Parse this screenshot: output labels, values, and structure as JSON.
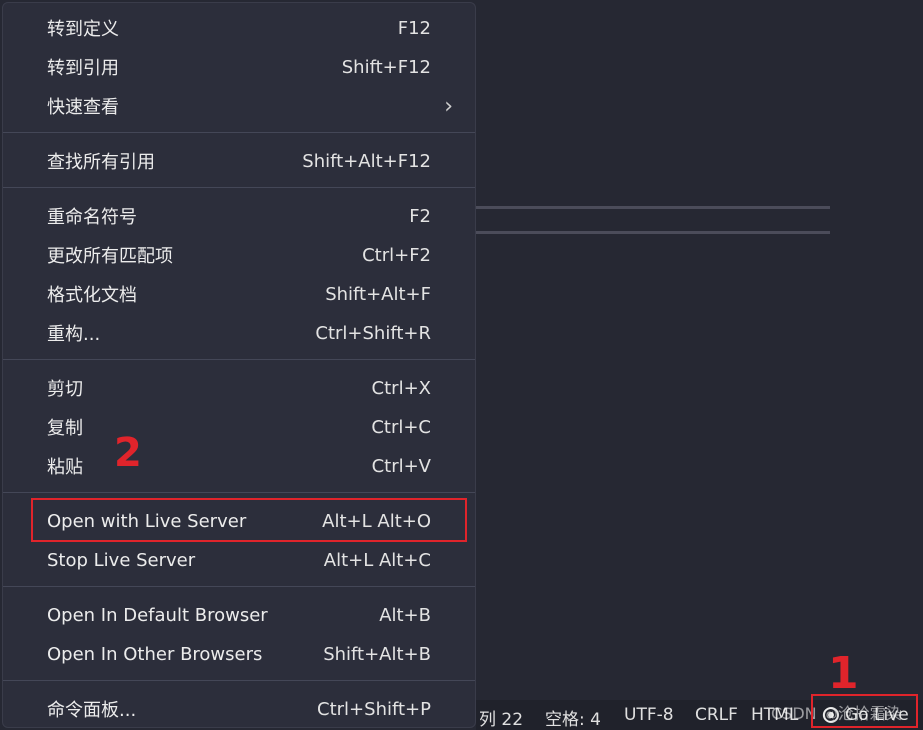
{
  "menu": {
    "items": [
      {
        "label": "转到定义",
        "shortcut": "F12"
      },
      {
        "label": "转到引用",
        "shortcut": "Shift+F12"
      },
      {
        "label": "快速查看",
        "shortcut": "",
        "submenu": true
      },
      {
        "label": "查找所有引用",
        "shortcut": "Shift+Alt+F12"
      },
      {
        "label": "重命名符号",
        "shortcut": "F2"
      },
      {
        "label": "更改所有匹配项",
        "shortcut": "Ctrl+F2"
      },
      {
        "label": "格式化文档",
        "shortcut": "Shift+Alt+F"
      },
      {
        "label": "重构...",
        "shortcut": "Ctrl+Shift+R"
      },
      {
        "label": "剪切",
        "shortcut": "Ctrl+X"
      },
      {
        "label": "复制",
        "shortcut": "Ctrl+C"
      },
      {
        "label": "粘贴",
        "shortcut": "Ctrl+V"
      },
      {
        "label": "Open with Live Server",
        "shortcut": "Alt+L Alt+O"
      },
      {
        "label": "Stop Live Server",
        "shortcut": "Alt+L Alt+C"
      },
      {
        "label": "Open In Default Browser",
        "shortcut": "Alt+B"
      },
      {
        "label": "Open In Other Browsers",
        "shortcut": "Shift+Alt+B"
      },
      {
        "label": "命令面板...",
        "shortcut": "Ctrl+Shift+P"
      }
    ],
    "chevron": "›"
  },
  "annotations": {
    "one": "1",
    "two": "2",
    "color": "#e0242b"
  },
  "statusbar": {
    "column": "列 22",
    "spaces": "空格: 4",
    "encoding": "UTF-8",
    "eol": "CRLF",
    "language": "HTML",
    "golive": "Go Live",
    "golive_icon": "broadcast-icon"
  },
  "watermark": "CSDN @沧拾霜染"
}
